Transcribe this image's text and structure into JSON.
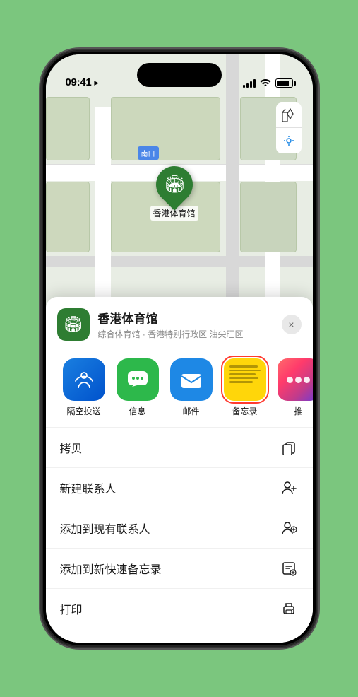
{
  "status_bar": {
    "time": "09:41",
    "location_arrow": "▸"
  },
  "map": {
    "label": "南口",
    "controls": {
      "map_icon": "🗺",
      "location_icon": "➤"
    },
    "pin_label": "香港体育馆"
  },
  "bottom_sheet": {
    "venue_icon": "🏟",
    "venue_name": "香港体育馆",
    "venue_subtitle": "综合体育馆 · 香港特别行政区 油尖旺区",
    "close_label": "×",
    "share_items": [
      {
        "label": "隔空投送",
        "type": "airdrop"
      },
      {
        "label": "信息",
        "type": "messages"
      },
      {
        "label": "邮件",
        "type": "mail"
      },
      {
        "label": "备忘录",
        "type": "notes"
      },
      {
        "label": "推",
        "type": "more"
      }
    ],
    "actions": [
      {
        "label": "拷贝",
        "icon": "copy"
      },
      {
        "label": "新建联系人",
        "icon": "person-add"
      },
      {
        "label": "添加到现有联系人",
        "icon": "person-plus"
      },
      {
        "label": "添加到新快速备忘录",
        "icon": "note-add"
      },
      {
        "label": "打印",
        "icon": "printer"
      }
    ]
  }
}
